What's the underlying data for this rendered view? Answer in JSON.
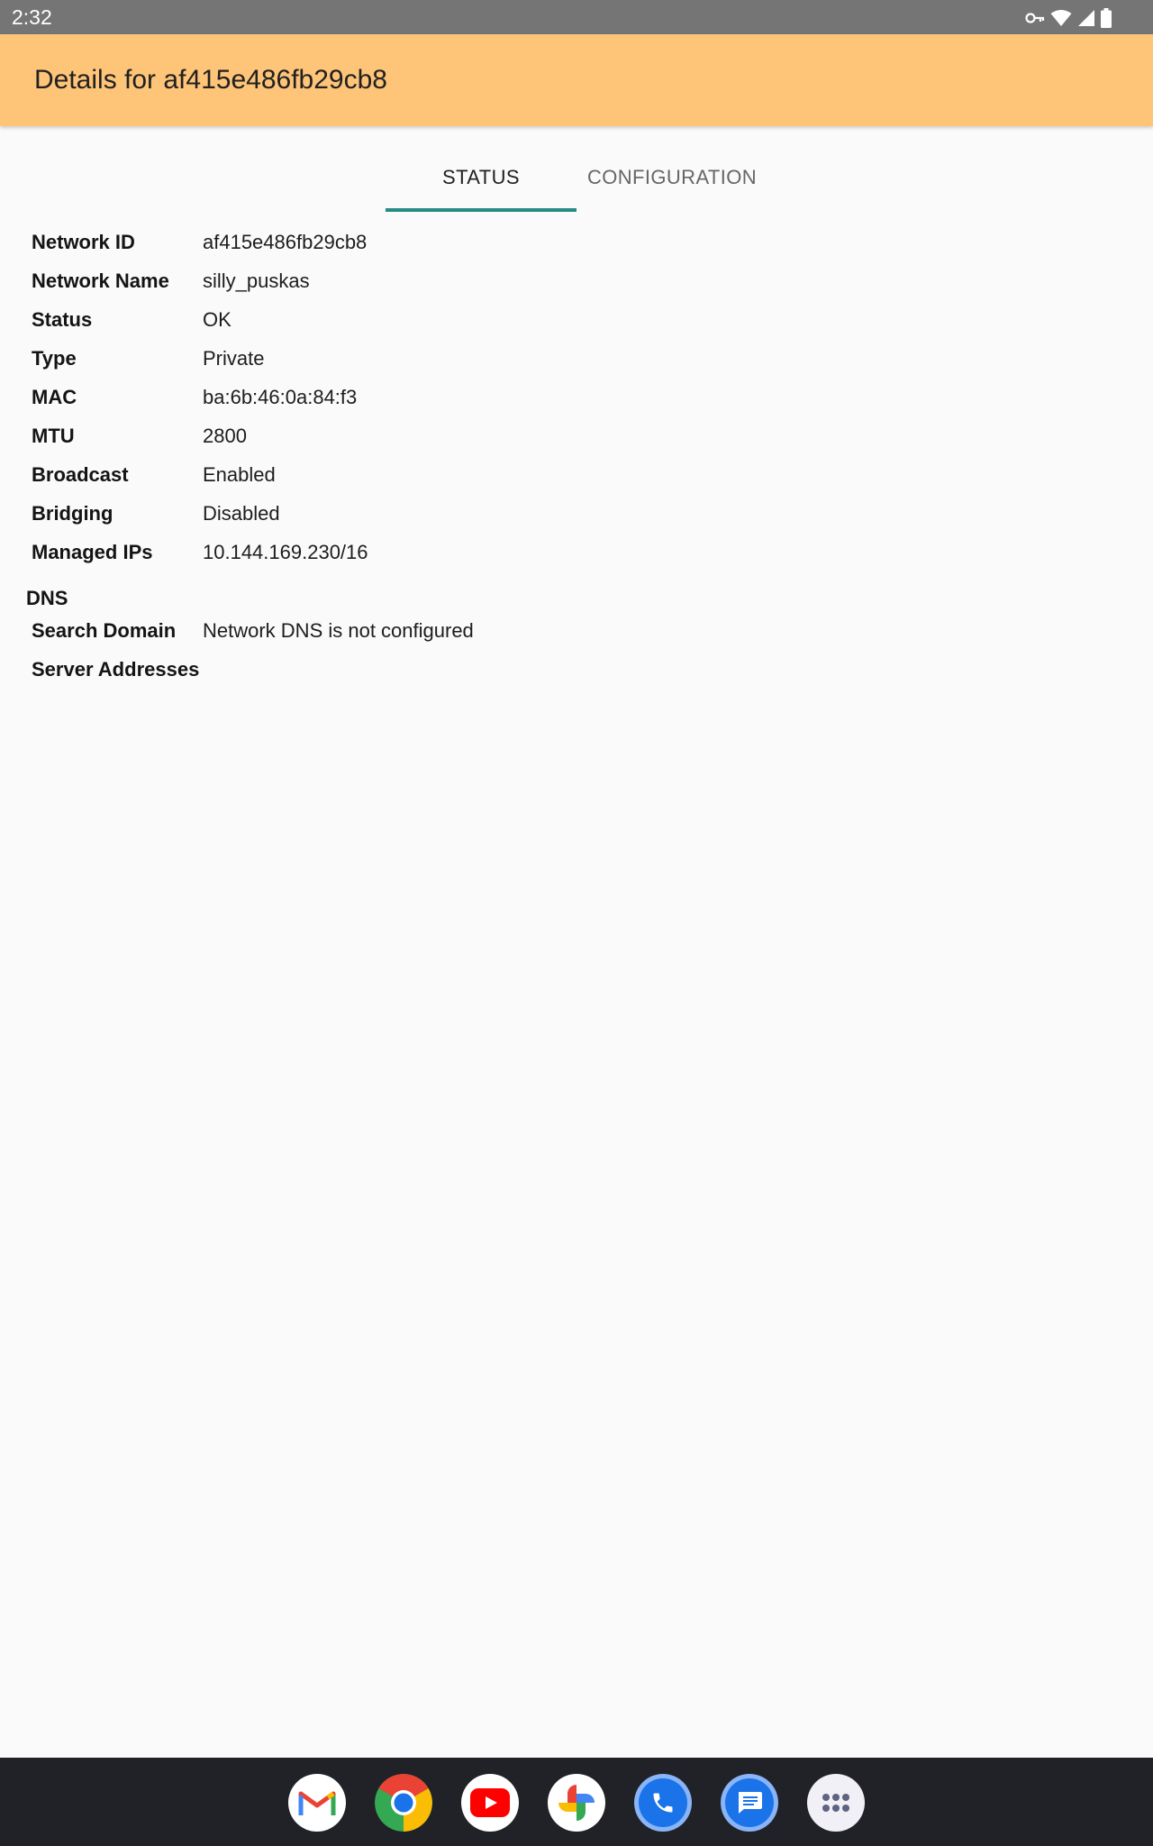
{
  "status_bar": {
    "time": "2:32"
  },
  "app_bar": {
    "title": "Details for af415e486fb29cb8"
  },
  "tabs": [
    {
      "label": "STATUS",
      "selected": true
    },
    {
      "label": "CONFIGURATION",
      "selected": false
    }
  ],
  "details": [
    {
      "label": "Network ID",
      "value": "af415e486fb29cb8"
    },
    {
      "label": "Network Name",
      "value": "silly_puskas"
    },
    {
      "label": "Status",
      "value": "OK"
    },
    {
      "label": "Type",
      "value": "Private"
    },
    {
      "label": "MAC",
      "value": "ba:6b:46:0a:84:f3"
    },
    {
      "label": "MTU",
      "value": "2800"
    },
    {
      "label": "Broadcast",
      "value": "Enabled"
    },
    {
      "label": "Bridging",
      "value": "Disabled"
    },
    {
      "label": "Managed IPs",
      "value": "10.144.169.230/16"
    }
  ],
  "dns": {
    "header": "DNS",
    "rows": [
      {
        "label": "Search Domain",
        "value": "Network DNS is not configured"
      },
      {
        "label": "Server Addresses",
        "value": ""
      }
    ]
  },
  "colors": {
    "app_bar": "#fec478",
    "tab_indicator": "#268c85",
    "status_bar": "#757575",
    "nav_bar": "#212227"
  },
  "dock": [
    {
      "icon": "gmail-icon"
    },
    {
      "icon": "chrome-icon"
    },
    {
      "icon": "youtube-icon"
    },
    {
      "icon": "photos-icon"
    },
    {
      "icon": "phone-icon"
    },
    {
      "icon": "messages-icon"
    },
    {
      "icon": "app-drawer-icon"
    }
  ]
}
